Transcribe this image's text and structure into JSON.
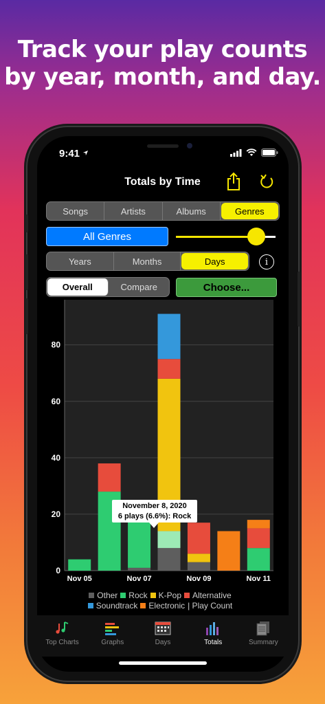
{
  "headline": {
    "line1": "Track your play counts",
    "line2": "by year, month, and day."
  },
  "status": {
    "time": "9:41"
  },
  "nav": {
    "title": "Totals by Time"
  },
  "category_seg": {
    "options": [
      "Songs",
      "Artists",
      "Albums",
      "Genres"
    ],
    "selected": "Genres"
  },
  "genre_button": {
    "label": "All Genres"
  },
  "slider": {
    "value": 0.82
  },
  "period_seg": {
    "options": [
      "Years",
      "Months",
      "Days"
    ],
    "selected": "Days"
  },
  "info_button": {
    "label": "i"
  },
  "mode_seg": {
    "options": [
      "Overall",
      "Compare"
    ],
    "selected": "Overall"
  },
  "choose_button": {
    "label": "Choose..."
  },
  "colors": {
    "Other": "#5e5e5e",
    "Rock": "#2ecc71",
    "K-Pop": "#f1c40f",
    "Alternative": "#e74c3c",
    "Soundtrack": "#3498db",
    "Electronic": "#f57f17",
    "accent_yellow": "#f6e600",
    "blue": "#007aff",
    "green": "#3c9a3c"
  },
  "chart_data": {
    "type": "bar",
    "stacked": true,
    "categories": [
      "Nov 05",
      "Nov 06",
      "Nov 07",
      "Nov 08",
      "Nov 09",
      "Nov 10",
      "Nov 11"
    ],
    "x_tick_labels": [
      "Nov 05",
      "Nov 07",
      "Nov 09",
      "Nov 11"
    ],
    "y_ticks": [
      0,
      20,
      40,
      60,
      80
    ],
    "ylim": [
      0,
      96
    ],
    "grid": true,
    "legend_position": "bottom",
    "series": [
      {
        "name": "Other",
        "values": [
          0,
          0,
          1,
          8,
          3,
          0,
          0
        ]
      },
      {
        "name": "Rock",
        "values": [
          4,
          28,
          18,
          6,
          0,
          0,
          8
        ]
      },
      {
        "name": "K-Pop",
        "values": [
          0,
          0,
          0,
          54,
          3,
          0,
          0
        ]
      },
      {
        "name": "Alternative",
        "values": [
          0,
          10,
          0,
          7,
          11,
          0,
          7
        ]
      },
      {
        "name": "Soundtrack",
        "values": [
          0,
          0,
          0,
          16,
          0,
          0,
          0
        ]
      },
      {
        "name": "Electronic",
        "values": [
          0,
          0,
          0,
          0,
          0,
          14,
          3
        ]
      }
    ],
    "legend_suffix": "| Play Count",
    "tooltip": {
      "line1": "November 8, 2020",
      "line2": "6 plays (6.6%): Rock"
    }
  },
  "tabs": [
    {
      "label": "Top Charts",
      "icon": "music-notes-icon",
      "active": false
    },
    {
      "label": "Graphs",
      "icon": "bar-graph-icon",
      "active": false
    },
    {
      "label": "Days",
      "icon": "calendar-icon",
      "active": false
    },
    {
      "label": "Totals",
      "icon": "totals-bars-icon",
      "active": true
    },
    {
      "label": "Summary",
      "icon": "summary-pages-icon",
      "active": false
    }
  ]
}
